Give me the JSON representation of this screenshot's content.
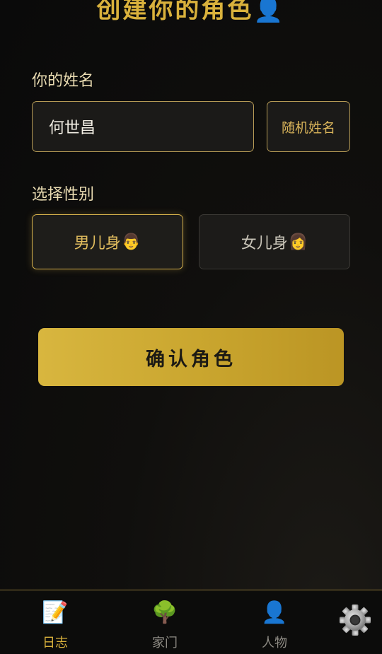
{
  "page": {
    "title": "创建你的角色👤"
  },
  "name_section": {
    "label": "你的姓名",
    "input_value": "何世昌",
    "random_label": "随机姓名"
  },
  "gender_section": {
    "label": "选择性别",
    "options": [
      {
        "label": "男儿身",
        "emoji": "👨",
        "selected": true
      },
      {
        "label": "女儿身",
        "emoji": "👩",
        "selected": false
      }
    ]
  },
  "confirm": {
    "label": "确认角色"
  },
  "bottom_nav": {
    "items": [
      {
        "label": "日志",
        "icon": "📝",
        "icon_name": "memo-icon",
        "active": true
      },
      {
        "label": "家门",
        "icon": "🌳",
        "icon_name": "tree-icon",
        "active": false
      },
      {
        "label": "人物",
        "icon": "👤",
        "icon_name": "person-icon",
        "active": false
      }
    ],
    "settings_icon_name": "gear-icon"
  },
  "colors": {
    "accent_gold": "#d9b13c",
    "background": "#0a0a0a",
    "button_gold": "#c9a52e"
  }
}
